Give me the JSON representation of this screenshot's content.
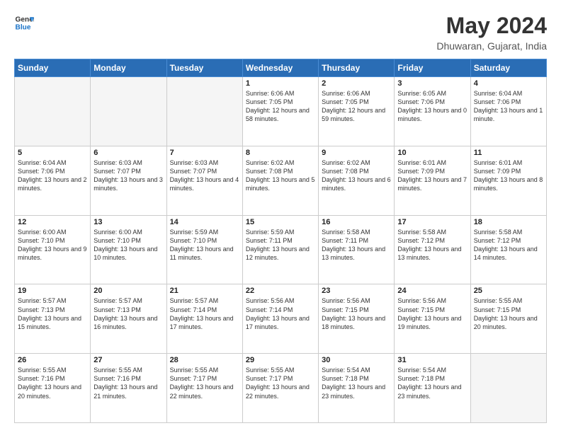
{
  "header": {
    "logo_line1": "General",
    "logo_line2": "Blue",
    "month": "May 2024",
    "location": "Dhuwaran, Gujarat, India"
  },
  "weekdays": [
    "Sunday",
    "Monday",
    "Tuesday",
    "Wednesday",
    "Thursday",
    "Friday",
    "Saturday"
  ],
  "weeks": [
    [
      {
        "day": "",
        "info": ""
      },
      {
        "day": "",
        "info": ""
      },
      {
        "day": "",
        "info": ""
      },
      {
        "day": "1",
        "info": "Sunrise: 6:06 AM\nSunset: 7:05 PM\nDaylight: 12 hours\nand 58 minutes."
      },
      {
        "day": "2",
        "info": "Sunrise: 6:06 AM\nSunset: 7:05 PM\nDaylight: 12 hours\nand 59 minutes."
      },
      {
        "day": "3",
        "info": "Sunrise: 6:05 AM\nSunset: 7:06 PM\nDaylight: 13 hours\nand 0 minutes."
      },
      {
        "day": "4",
        "info": "Sunrise: 6:04 AM\nSunset: 7:06 PM\nDaylight: 13 hours\nand 1 minute."
      }
    ],
    [
      {
        "day": "5",
        "info": "Sunrise: 6:04 AM\nSunset: 7:06 PM\nDaylight: 13 hours\nand 2 minutes."
      },
      {
        "day": "6",
        "info": "Sunrise: 6:03 AM\nSunset: 7:07 PM\nDaylight: 13 hours\nand 3 minutes."
      },
      {
        "day": "7",
        "info": "Sunrise: 6:03 AM\nSunset: 7:07 PM\nDaylight: 13 hours\nand 4 minutes."
      },
      {
        "day": "8",
        "info": "Sunrise: 6:02 AM\nSunset: 7:08 PM\nDaylight: 13 hours\nand 5 minutes."
      },
      {
        "day": "9",
        "info": "Sunrise: 6:02 AM\nSunset: 7:08 PM\nDaylight: 13 hours\nand 6 minutes."
      },
      {
        "day": "10",
        "info": "Sunrise: 6:01 AM\nSunset: 7:09 PM\nDaylight: 13 hours\nand 7 minutes."
      },
      {
        "day": "11",
        "info": "Sunrise: 6:01 AM\nSunset: 7:09 PM\nDaylight: 13 hours\nand 8 minutes."
      }
    ],
    [
      {
        "day": "12",
        "info": "Sunrise: 6:00 AM\nSunset: 7:10 PM\nDaylight: 13 hours\nand 9 minutes."
      },
      {
        "day": "13",
        "info": "Sunrise: 6:00 AM\nSunset: 7:10 PM\nDaylight: 13 hours\nand 10 minutes."
      },
      {
        "day": "14",
        "info": "Sunrise: 5:59 AM\nSunset: 7:10 PM\nDaylight: 13 hours\nand 11 minutes."
      },
      {
        "day": "15",
        "info": "Sunrise: 5:59 AM\nSunset: 7:11 PM\nDaylight: 13 hours\nand 12 minutes."
      },
      {
        "day": "16",
        "info": "Sunrise: 5:58 AM\nSunset: 7:11 PM\nDaylight: 13 hours\nand 13 minutes."
      },
      {
        "day": "17",
        "info": "Sunrise: 5:58 AM\nSunset: 7:12 PM\nDaylight: 13 hours\nand 13 minutes."
      },
      {
        "day": "18",
        "info": "Sunrise: 5:58 AM\nSunset: 7:12 PM\nDaylight: 13 hours\nand 14 minutes."
      }
    ],
    [
      {
        "day": "19",
        "info": "Sunrise: 5:57 AM\nSunset: 7:13 PM\nDaylight: 13 hours\nand 15 minutes."
      },
      {
        "day": "20",
        "info": "Sunrise: 5:57 AM\nSunset: 7:13 PM\nDaylight: 13 hours\nand 16 minutes."
      },
      {
        "day": "21",
        "info": "Sunrise: 5:57 AM\nSunset: 7:14 PM\nDaylight: 13 hours\nand 17 minutes."
      },
      {
        "day": "22",
        "info": "Sunrise: 5:56 AM\nSunset: 7:14 PM\nDaylight: 13 hours\nand 17 minutes."
      },
      {
        "day": "23",
        "info": "Sunrise: 5:56 AM\nSunset: 7:15 PM\nDaylight: 13 hours\nand 18 minutes."
      },
      {
        "day": "24",
        "info": "Sunrise: 5:56 AM\nSunset: 7:15 PM\nDaylight: 13 hours\nand 19 minutes."
      },
      {
        "day": "25",
        "info": "Sunrise: 5:55 AM\nSunset: 7:15 PM\nDaylight: 13 hours\nand 20 minutes."
      }
    ],
    [
      {
        "day": "26",
        "info": "Sunrise: 5:55 AM\nSunset: 7:16 PM\nDaylight: 13 hours\nand 20 minutes."
      },
      {
        "day": "27",
        "info": "Sunrise: 5:55 AM\nSunset: 7:16 PM\nDaylight: 13 hours\nand 21 minutes."
      },
      {
        "day": "28",
        "info": "Sunrise: 5:55 AM\nSunset: 7:17 PM\nDaylight: 13 hours\nand 22 minutes."
      },
      {
        "day": "29",
        "info": "Sunrise: 5:55 AM\nSunset: 7:17 PM\nDaylight: 13 hours\nand 22 minutes."
      },
      {
        "day": "30",
        "info": "Sunrise: 5:54 AM\nSunset: 7:18 PM\nDaylight: 13 hours\nand 23 minutes."
      },
      {
        "day": "31",
        "info": "Sunrise: 5:54 AM\nSunset: 7:18 PM\nDaylight: 13 hours\nand 23 minutes."
      },
      {
        "day": "",
        "info": ""
      }
    ]
  ]
}
